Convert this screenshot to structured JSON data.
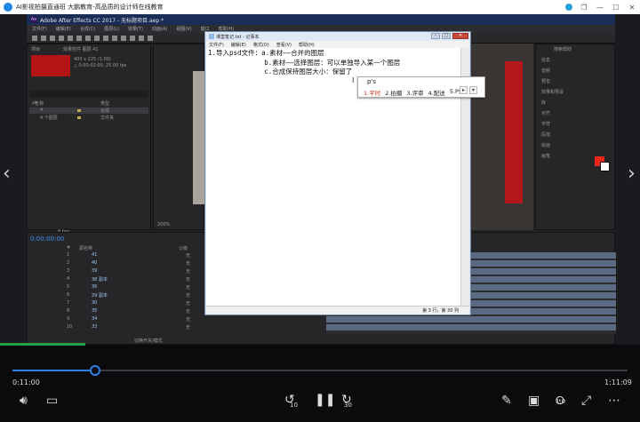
{
  "player": {
    "title": "AI影视拍摄直通班 大鹏教育-高品质的设计师在线教育",
    "current_time": "0:11:00",
    "total_time": "1:11:09",
    "progress": 0.134,
    "skip_back": "10",
    "skip_forward": "30",
    "speed": "1.0"
  },
  "ae": {
    "title": "Adobe After Effects CC 2017 - 无标题项目.aep *",
    "menu": [
      "文件(F)",
      "编辑(E)",
      "合成(C)",
      "图层(L)",
      "效果(T)",
      "动画(A)",
      "视图(V)",
      "窗口",
      "帮助(H)"
    ],
    "project_panel": {
      "tab": "项目",
      "tab2": "效果控件 图层 41",
      "item_info": [
        "400 x 225 (1.00)",
        "△ 0:00:02:00, 25.00 fps"
      ],
      "search_placeholder": "ρ▾",
      "columns": [
        "名称",
        "类型"
      ],
      "rows": [
        {
          "name": "4",
          "color": "#c7a84c",
          "type": "合成"
        },
        {
          "name": "4 个图层",
          "color": "#c7a84c",
          "type": "文件夹"
        }
      ],
      "bpc": "8 bpc"
    },
    "zoom": "200%",
    "timeline": {
      "timecode": "0:00:00:00",
      "columns": [
        "#",
        "源名称",
        "父级"
      ],
      "layers": [
        {
          "num": "1",
          "name": "41",
          "parent": "无"
        },
        {
          "num": "2",
          "name": "40",
          "parent": "无"
        },
        {
          "num": "3",
          "name": "39",
          "parent": "无"
        },
        {
          "num": "4",
          "name": "38 副本",
          "parent": "无"
        },
        {
          "num": "5",
          "name": "36",
          "parent": "无"
        },
        {
          "num": "6",
          "name": "29 副本",
          "parent": "无"
        },
        {
          "num": "7",
          "name": "30",
          "parent": "无"
        },
        {
          "num": "8",
          "name": "35",
          "parent": "无"
        },
        {
          "num": "9",
          "name": "34",
          "parent": "无"
        },
        {
          "num": "10",
          "name": "33",
          "parent": "无"
        }
      ],
      "footer": "切换开关/模式"
    },
    "right_panel": {
      "header": "搜索帮助",
      "items": [
        "信息",
        "音频",
        "预览",
        "效果和预设",
        "库",
        "对齐",
        "字符",
        "段落",
        "绘画",
        "画笔"
      ]
    }
  },
  "notepad": {
    "title": "课堂笔记.txt - 记事本",
    "menu": [
      "文件(F)",
      "编辑(E)",
      "格式(O)",
      "查看(V)",
      "帮助(H)"
    ],
    "lines": [
      "1.导入psd文件：a.素材——合并的图层",
      "              b.素材——选择图层：可以单独导入某一个图层",
      "              c.合成保持图层大小：保留了"
    ],
    "status": "第 3 行，第 30 列"
  },
  "ime": {
    "composition": "p's",
    "candidates": [
      "1.平时",
      "2.拍摄",
      "3.评审",
      "4.配送",
      "5.PS"
    ]
  }
}
